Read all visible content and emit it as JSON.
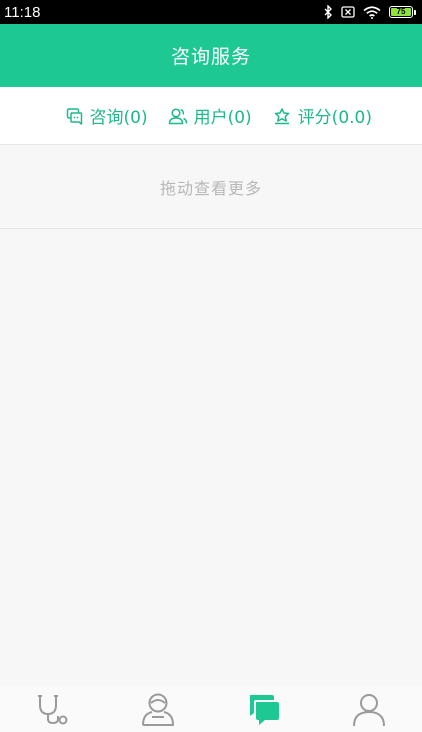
{
  "status_bar": {
    "time": "11:18",
    "battery_level": "75"
  },
  "header": {
    "title": "咨询服务"
  },
  "stats": [
    {
      "icon": "consult-icon",
      "label": "咨询(0)"
    },
    {
      "icon": "users-icon",
      "label": "用户(0)"
    },
    {
      "icon": "rating-icon",
      "label": "评分(0.0)"
    }
  ],
  "list": {
    "load_more": "拖动查看更多"
  },
  "bottom_nav": [
    {
      "icon": "stethoscope-icon",
      "active": false
    },
    {
      "icon": "doctor-icon",
      "active": false
    },
    {
      "icon": "chat-icon",
      "active": true
    },
    {
      "icon": "profile-icon",
      "active": false
    }
  ],
  "colors": {
    "brand": "#1dc893",
    "accent_text": "#1db98a",
    "inactive_icon": "#9a9a9a",
    "hint_text": "#b8b8b8"
  }
}
